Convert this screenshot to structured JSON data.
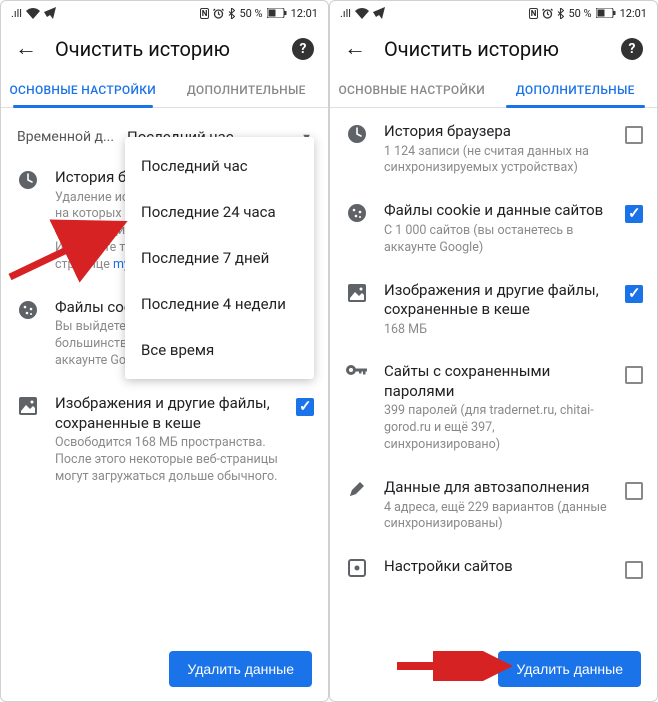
{
  "status": {
    "time": "12:01",
    "battery": "50 %",
    "icons_left": "📶 ✈",
    "icons_right": "ⓃⒽ ⏰ ✱"
  },
  "header": {
    "title": "Очистить историю"
  },
  "left": {
    "tabs": {
      "basic": "ОСНОВНЫЕ НАСТРОЙКИ",
      "advanced": "ДОПОЛНИТЕЛЬНЫЕ"
    },
    "time_label": "Временной д...",
    "time_value": "Последний час",
    "dropdown": [
      "Последний час",
      "Последние 24 часа",
      "Последние 7 дней",
      "Последние 4 недели",
      "Все время"
    ],
    "items": [
      {
        "title": "История браузера",
        "sub_pre": "Удаление истории со всех устройств, на которых выполнен вход. Информация о ваших действиях в Интернете также хранится на странице ",
        "sub_link": "myactivity.google.com",
        "checked": false
      },
      {
        "title": "Файлы cookie и данные сайтов",
        "sub": "Вы выйдете из аккаунтов на большинстве сайтов, но останетесь в аккаунте Google.",
        "checked": false
      },
      {
        "title": "Изображения и другие файлы, сохраненные в кеше",
        "sub": "Освободится 168 МБ пространства. После этого некоторые веб-страницы могут загружаться дольше обычного.",
        "checked": true
      }
    ],
    "delete_label": "Удалить данные"
  },
  "right": {
    "tabs": {
      "basic": "ОСНОВНЫЕ НАСТРОЙКИ",
      "advanced": "ДОПОЛНИТЕЛЬНЫЕ"
    },
    "items": [
      {
        "title": "История браузера",
        "sub": "1 124 записи (не считая данных на синхронизируемых устройствах)",
        "checked": false
      },
      {
        "title": "Файлы cookie и данные сайтов",
        "sub": "С 1 000 сайтов (вы останетесь в аккаунте Google)",
        "checked": true
      },
      {
        "title": "Изображения и другие файлы, сохраненные в кеше",
        "sub": "168 МБ",
        "checked": true
      },
      {
        "title": "Сайты с сохраненными паролями",
        "sub": "399 паролей (для tradernet.ru, chitai-gorod.ru и ещё 397, синхронизировано)",
        "checked": false
      },
      {
        "title": "Данные для автозаполнения",
        "sub": "4 адреса, ещё 229 вариантов (данные синхронизированы)",
        "checked": false
      },
      {
        "title": "Настройки сайтов",
        "sub": "",
        "checked": false
      }
    ],
    "delete_label": "Удалить данные"
  }
}
